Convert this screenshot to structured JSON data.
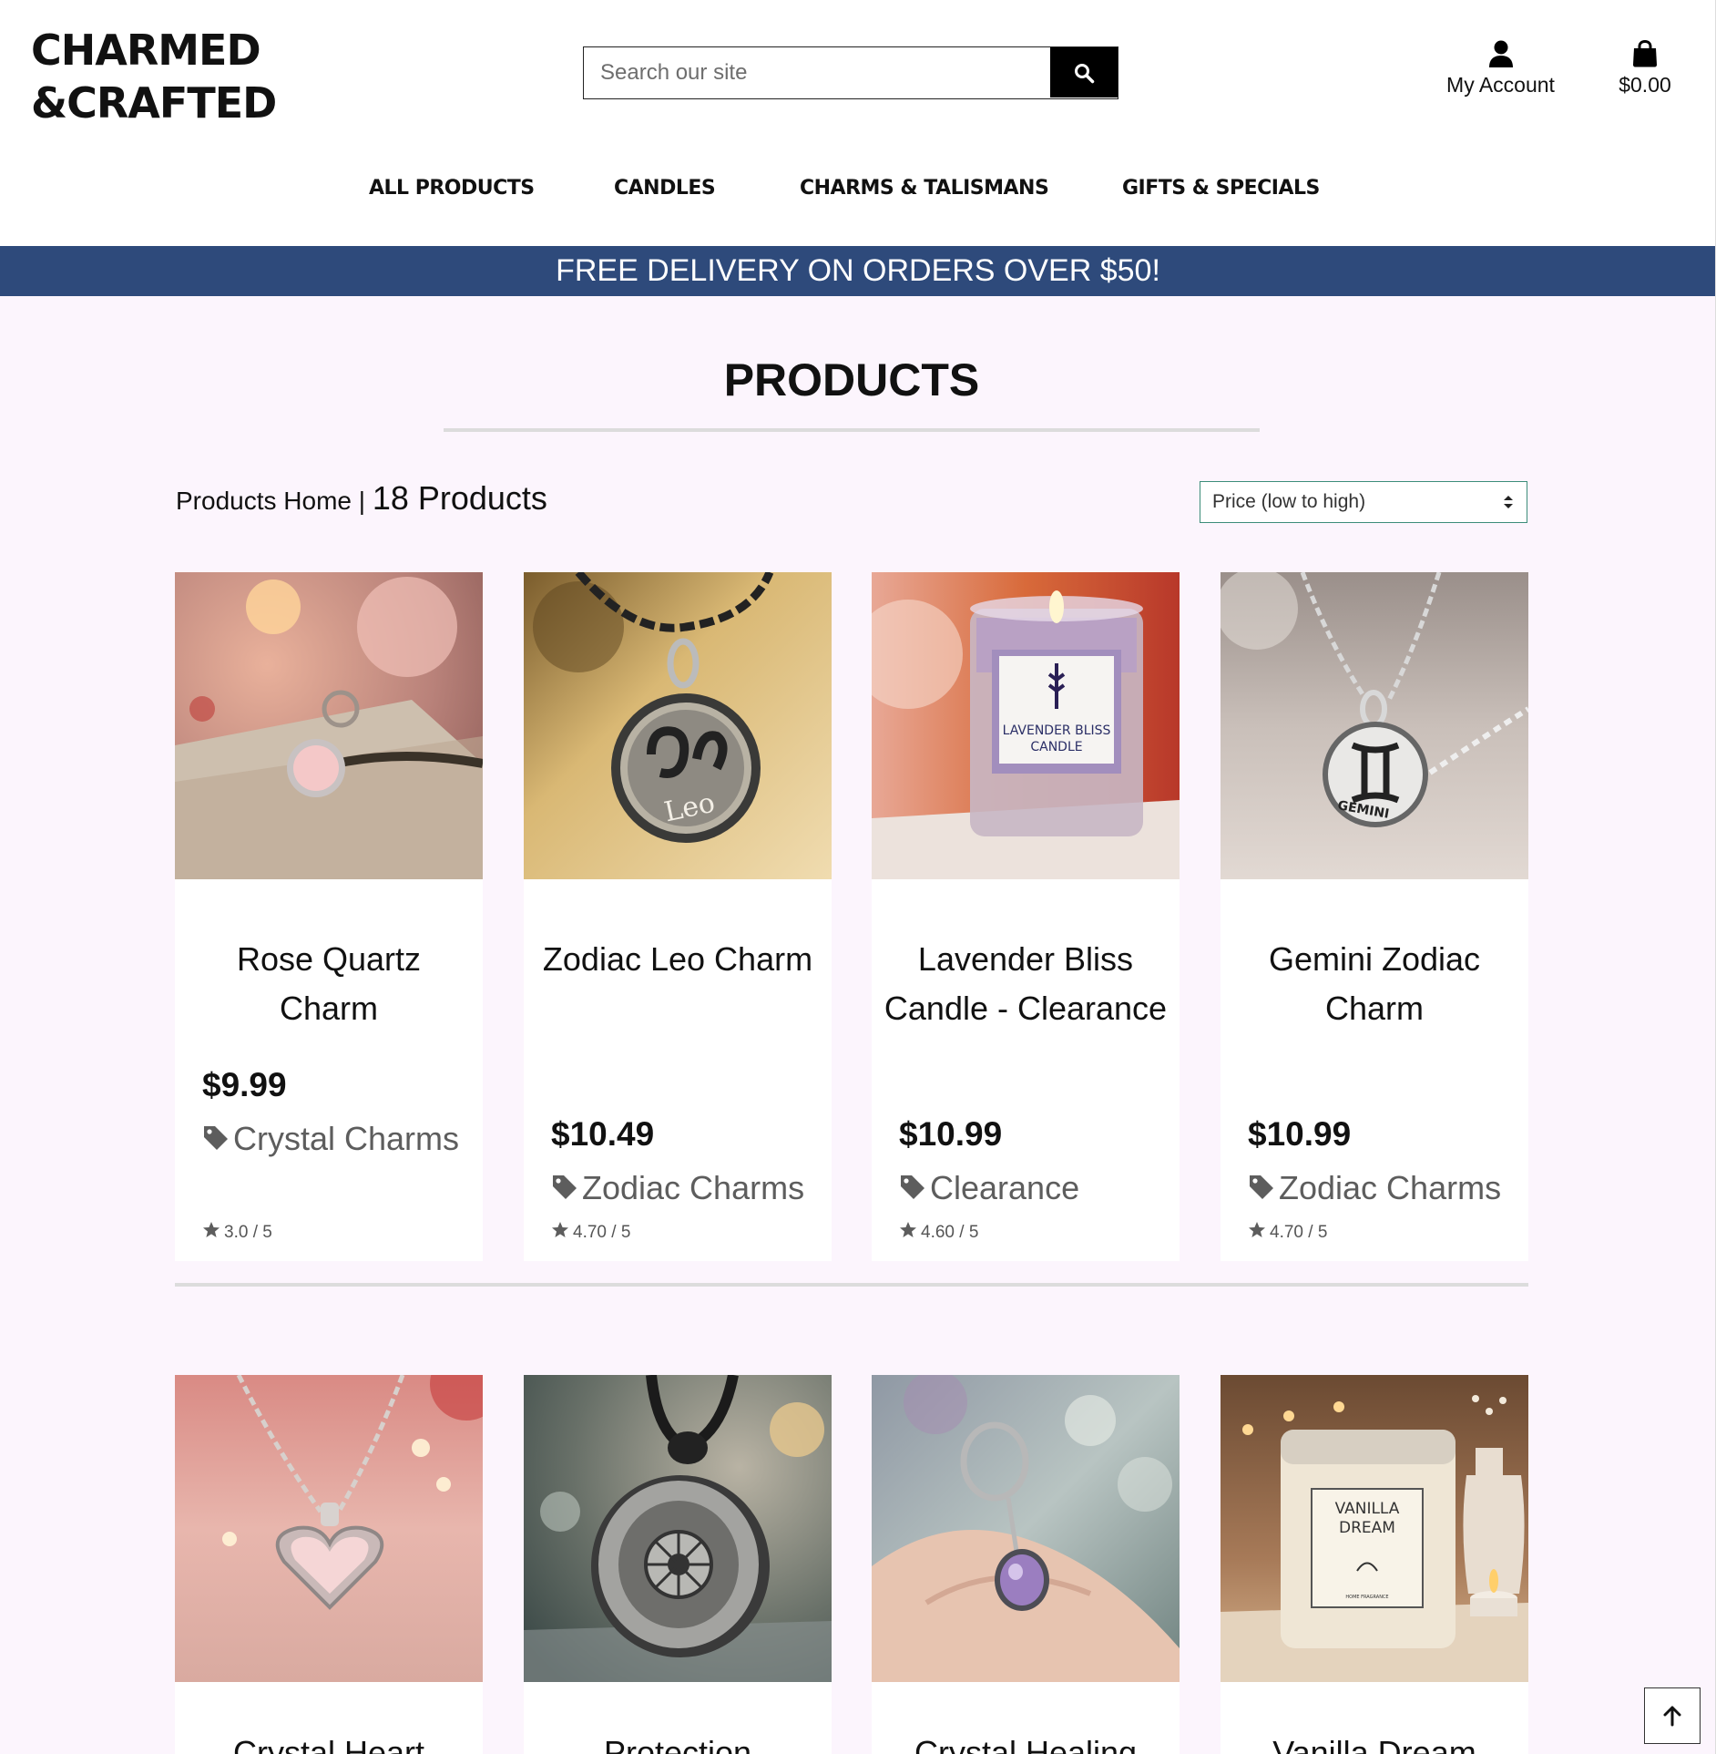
{
  "header": {
    "logo_line1": "CHARMED",
    "logo_line2": "&CRAFTED",
    "search_placeholder": "Search our site",
    "account_label": "My Account",
    "cart_total": "$0.00"
  },
  "nav": {
    "items": [
      "ALL PRODUCTS",
      "CANDLES",
      "CHARMS & TALISMANS",
      "GIFTS & SPECIALS"
    ]
  },
  "banner": "FREE DELIVERY ON ORDERS OVER $50!",
  "page_title": "PRODUCTS",
  "breadcrumb": {
    "home": "Products Home",
    "separator": "|",
    "count": "18 Products"
  },
  "sort": {
    "selected": "Price (low to high)"
  },
  "products": [
    {
      "name": "Rose Quartz Charm",
      "price": "$9.99",
      "category": "Crystal Charms",
      "rating": "3.0 / 5",
      "image": "rose-quartz-charm"
    },
    {
      "name": "Zodiac Leo Charm",
      "price": "$10.49",
      "category": "Zodiac Charms",
      "rating": "4.70 / 5",
      "image": "zodiac-leo-charm"
    },
    {
      "name": "Lavender Bliss Candle - Clearance",
      "price": "$10.99",
      "category": "Clearance",
      "rating": "4.60 / 5",
      "image": "lavender-bliss-candle"
    },
    {
      "name": "Gemini Zodiac Charm",
      "price": "$10.99",
      "category": "Zodiac Charms",
      "rating": "4.70 / 5",
      "image": "gemini-zodiac-charm"
    },
    {
      "name": "Crystal Heart",
      "image": "crystal-heart-pendant"
    },
    {
      "name": "Protection",
      "image": "protection-amulet"
    },
    {
      "name": "Crystal Healing",
      "image": "crystal-healing-charm"
    },
    {
      "name": "Vanilla Dream",
      "image": "vanilla-dream-candle"
    }
  ],
  "image_text": {
    "lavender_label_line1": "LAVENDER BLISS",
    "lavender_label_line2": "CANDLE",
    "leo_label": "Leo",
    "gemini_label": "GEMINI",
    "vanilla_label_line1": "VANILLA",
    "vanilla_label_line2": "DREAM",
    "vanilla_label_line3": "HOME FRAGRANCE"
  },
  "icons": {
    "search": "search-icon",
    "account": "user-icon",
    "cart": "shopping-bag-icon",
    "category": "tag-icon",
    "rating": "star-icon",
    "sort": "sort-caret-icon",
    "back_to_top": "arrow-up-icon"
  },
  "colors": {
    "banner_bg": "#2e4a7b",
    "page_bg": "#fcf5fd",
    "sort_border": "#3c8d7a"
  }
}
